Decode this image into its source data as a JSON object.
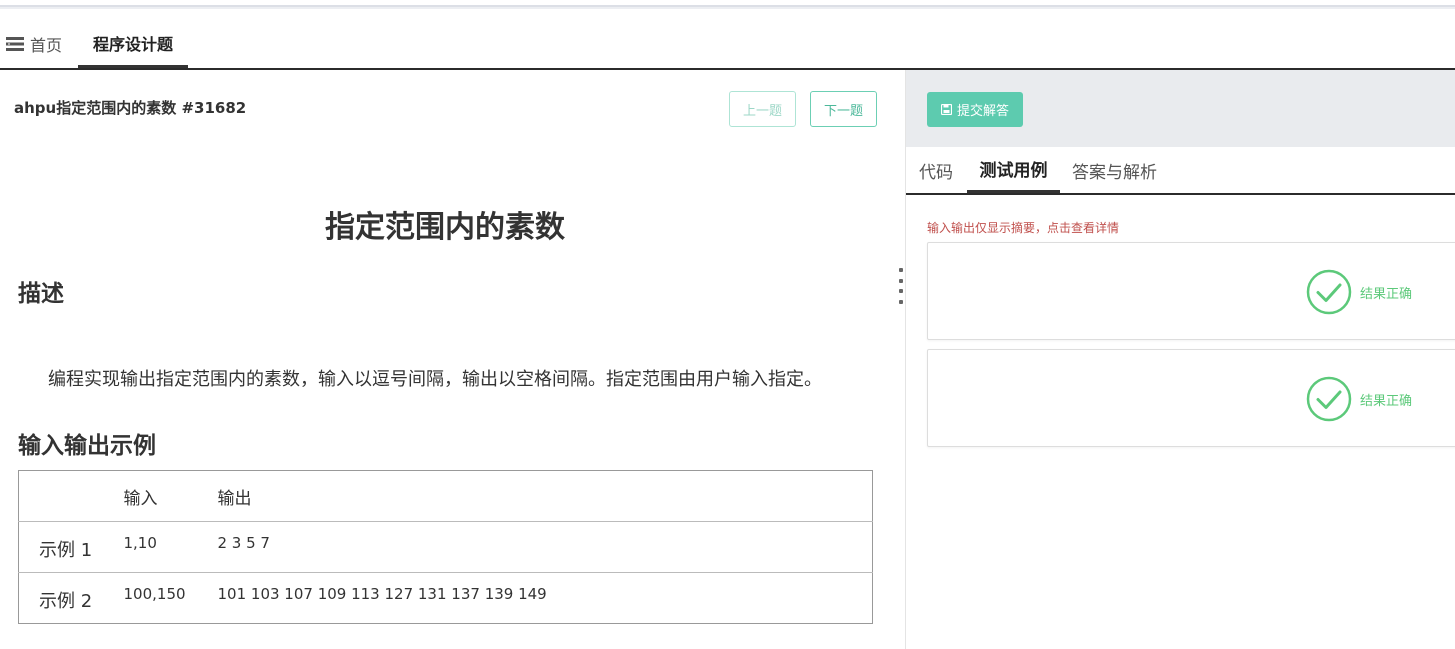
{
  "tabs": {
    "home_label": "首页",
    "problem_label": "程序设计题"
  },
  "problem": {
    "header_title": "ahpu指定范围内的素数 #31682",
    "prev_label": "上一题",
    "next_label": "下一题",
    "title": "指定范围内的素数",
    "desc_heading": "描述",
    "description": "编程实现输出指定范围内的素数，输入以逗号间隔，输出以空格间隔。指定范围由用户输入指定。",
    "examples_heading": "输入输出示例",
    "table": {
      "headers": [
        "",
        "输入",
        "输出"
      ],
      "rows": [
        [
          "示例 1",
          "1,10",
          "2 3 5 7"
        ],
        [
          "示例 2",
          "100,150",
          "101 103 107 109 113 127 131 137 139 149"
        ]
      ]
    }
  },
  "right": {
    "submit_label": "提交解答",
    "tabs": [
      "代码",
      "测试用例",
      "答案与解析"
    ],
    "hint": "输入输出仅显示摘要，点击查看详情",
    "results": [
      {
        "label": "结果正确"
      },
      {
        "label": "结果正确"
      }
    ]
  },
  "colors": {
    "accent": "#5dcbaf",
    "success": "#5cc97a",
    "hint": "#c0504d"
  }
}
